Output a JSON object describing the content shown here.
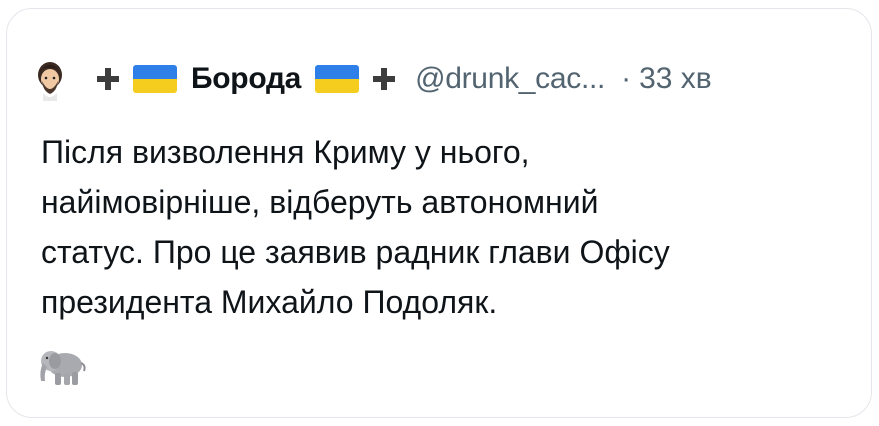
{
  "tweet": {
    "author": {
      "avatar_icon": "man-emoji-icon",
      "name": "Борода",
      "handle": "@drunk_cac...",
      "flag_colors": [
        "#2f7fe8",
        "#f5cd1e"
      ]
    },
    "separator": "·",
    "time": "33 хв",
    "lines": [
      "Після визволення Криму у нього,",
      "найімовірніше, відберуть автономний",
      "статус. Про це заявив радник глави Офісу",
      "президента Михайло Подоляк."
    ],
    "trailing_emoji": "elephant-icon"
  }
}
